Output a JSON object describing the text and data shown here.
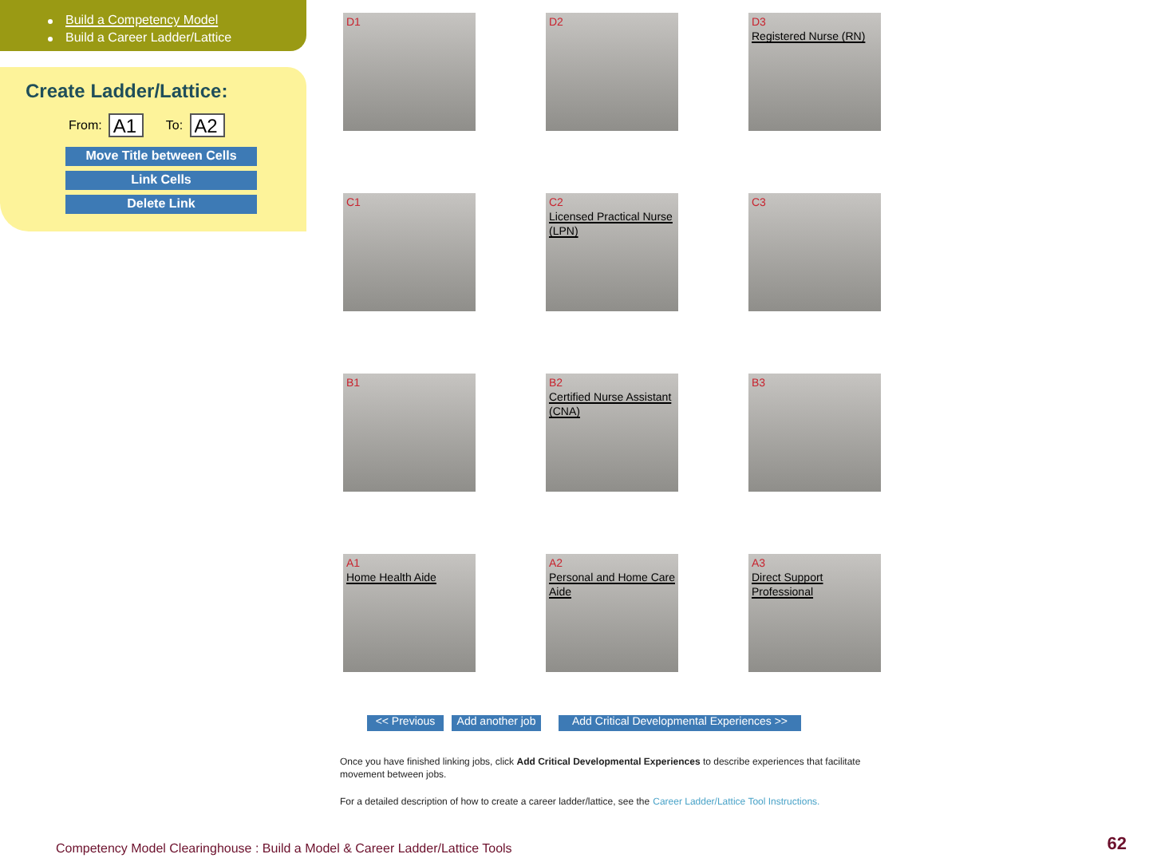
{
  "nav": {
    "items": [
      {
        "label": "Build a Competency Model",
        "kind": "link"
      },
      {
        "label": "Build a Career Ladder/Lattice",
        "kind": "plain"
      }
    ]
  },
  "create_panel": {
    "title": "Create Ladder/Lattice:",
    "from_label": "From:",
    "from_value": "A1",
    "to_label": "To:",
    "to_value": "A2",
    "buttons": [
      "Move Title between Cells",
      "Link Cells",
      "Delete Link"
    ]
  },
  "grid": {
    "cells": [
      {
        "code": "D1"
      },
      {
        "code": "D2"
      },
      {
        "code": "D3",
        "title": "Registered Nurse (RN)"
      },
      {
        "code": "C1"
      },
      {
        "code": "C2",
        "title": "Licensed Practical Nurse (LPN)"
      },
      {
        "code": "C3"
      },
      {
        "code": "B1"
      },
      {
        "code": "B2",
        "title": "Certified Nurse Assistant (CNA)"
      },
      {
        "code": "B3"
      },
      {
        "code": "A1",
        "title": "Home Health Aide"
      },
      {
        "code": "A2",
        "title": "Personal and Home Care Aide"
      },
      {
        "code": "A3",
        "title": "Direct Support Professional"
      }
    ]
  },
  "actions": [
    "<< Previous",
    "Add another job",
    "Add Critical Developmental Experiences >>"
  ],
  "instructions": {
    "paragraph": "Once you have finished linking jobs, click **Add Critical Developmental Experiences** to describe experiences that facilitate movement between jobs.",
    "detail_text": "For a detailed description of how to create a career ladder/lattice, see the",
    "detail_link": "Career Ladder/Lattice Tool Instructions."
  },
  "footer": {
    "text": "Competency Model Clearinghouse : Build a Model & Career Ladder/Lattice Tools",
    "page": "62"
  }
}
